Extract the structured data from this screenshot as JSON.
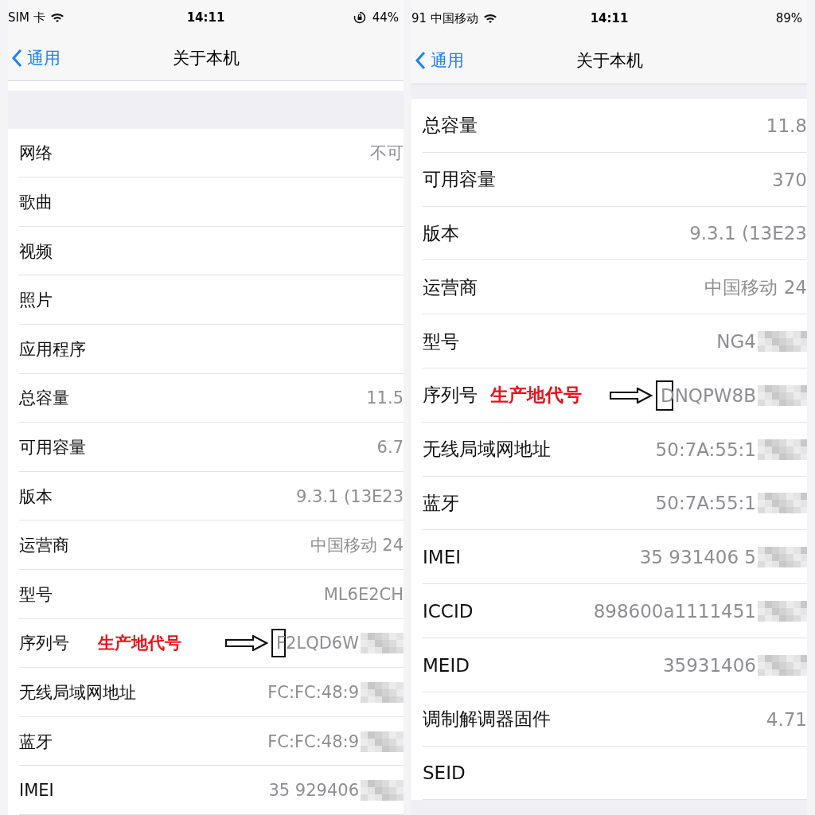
{
  "panels": [
    {
      "status_bar": {
        "carrier": "SIM 卡",
        "time": "14:11",
        "battery": "44%",
        "rotation_lock": true
      },
      "nav": {
        "back": "通用",
        "title": "关于本机"
      },
      "rows": [
        {
          "label": "网络",
          "value": "不可",
          "blurred": false
        },
        {
          "label": "歌曲",
          "blurred": false
        },
        {
          "label": "视频",
          "blurred": false
        },
        {
          "label": "照片",
          "blurred": false
        },
        {
          "label": "应用程序",
          "blurred": false
        },
        {
          "label": "总容量",
          "value": "11.5",
          "blurred": false
        },
        {
          "label": "可用容量",
          "value": "6.7",
          "blurred": false
        },
        {
          "label": "版本",
          "value": "9.3.1 (13E23",
          "blurred": false
        },
        {
          "label": "运营商",
          "value": "中国移动 24",
          "blurred": false
        },
        {
          "label": "型号",
          "value": "ML6E2CH",
          "blurred": false
        },
        {
          "label": "序列号",
          "value": "F2LQD6W",
          "blurred": true,
          "annotation": "生产地代号"
        },
        {
          "label": "无线局域网地址",
          "value": "FC:FC:48:9",
          "blurred": true
        },
        {
          "label": "蓝牙",
          "value": "FC:FC:48:9",
          "blurred": true
        },
        {
          "label": "IMEI",
          "value": "35 929406",
          "blurred": true
        }
      ]
    },
    {
      "status_bar": {
        "carrier": "91 中国移动",
        "time": "14:11",
        "battery": "89%",
        "rotation_lock": false
      },
      "nav": {
        "back": "通用",
        "title": "关于本机"
      },
      "rows": [
        {
          "label": "总容量",
          "value": "11.8",
          "blurred": false
        },
        {
          "label": "可用容量",
          "value": "370",
          "blurred": false
        },
        {
          "label": "版本",
          "value": "9.3.1 (13E23",
          "blurred": false
        },
        {
          "label": "运营商",
          "value": "中国移动 24",
          "blurred": false
        },
        {
          "label": "型号",
          "value": "NG4",
          "blurred": true
        },
        {
          "label": "序列号",
          "value": "DNQPW8B",
          "blurred": true,
          "annotation": "生产地代号"
        },
        {
          "label": "无线局域网地址",
          "value": "50:7A:55:1",
          "blurred": true
        },
        {
          "label": "蓝牙",
          "value": "50:7A:55:1",
          "blurred": true
        },
        {
          "label": "IMEI",
          "value": "35 931406 5",
          "blurred": true
        },
        {
          "label": "ICCID",
          "value": "898600a1111451",
          "blurred": true
        },
        {
          "label": "MEID",
          "value": "35931406",
          "blurred": true
        },
        {
          "label": "调制解调器固件",
          "value": "4.71",
          "blurred": false
        },
        {
          "label": "SEID",
          "blurred": false
        }
      ]
    }
  ]
}
